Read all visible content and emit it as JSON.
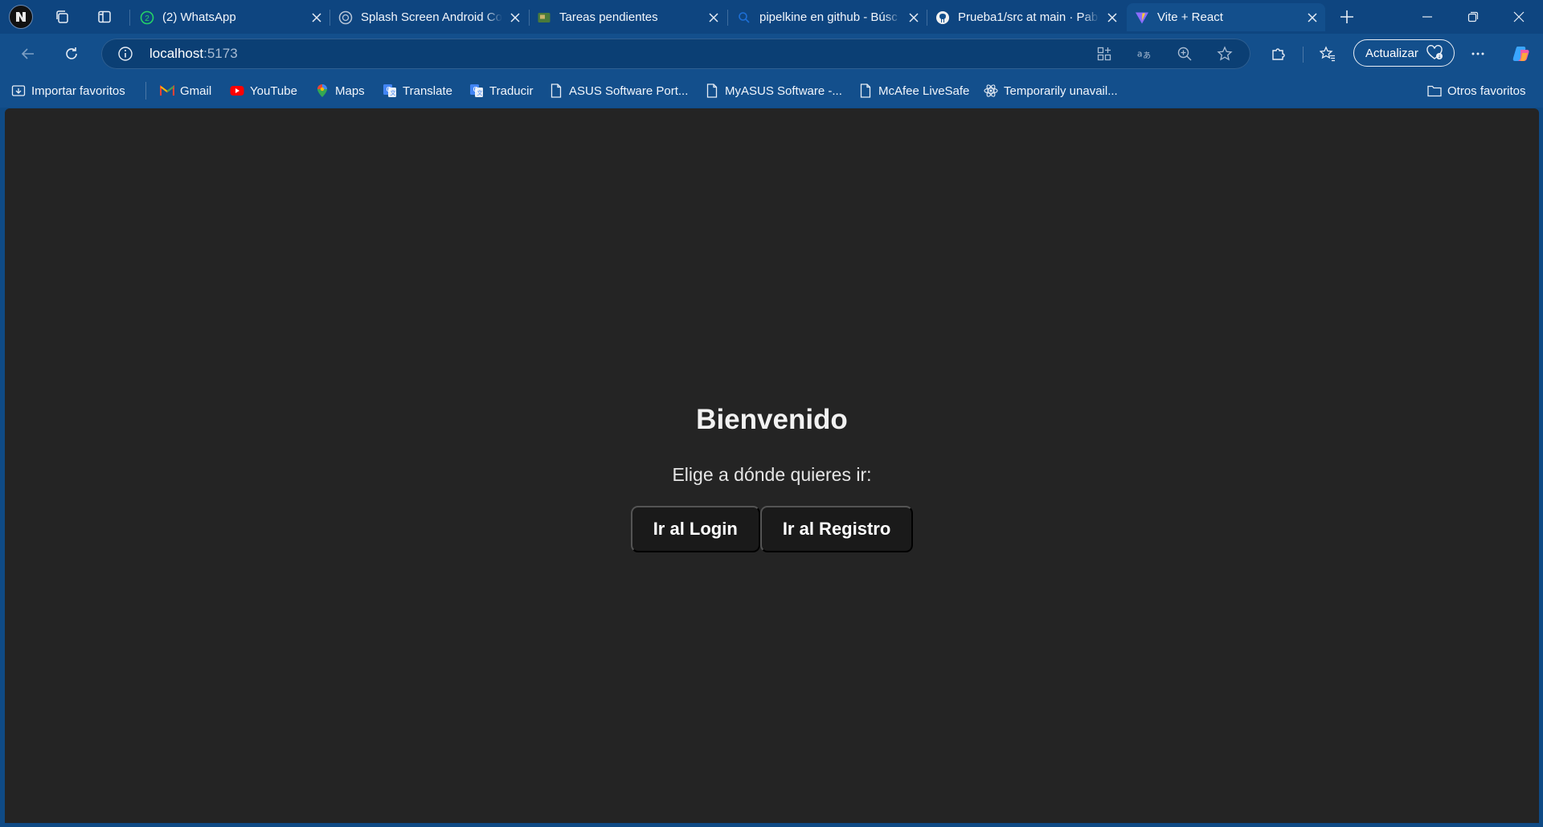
{
  "colors": {
    "chrome": "#134f8c",
    "tabstrip": "#0e4580",
    "page_bg": "#242424",
    "button_bg": "#1a1a1a"
  },
  "tabs": [
    {
      "title": "(2) WhatsApp",
      "icon": "whatsapp-icon"
    },
    {
      "title": "Splash Screen Android Co",
      "icon": "web-icon"
    },
    {
      "title": "Tareas pendientes",
      "icon": "tasks-icon"
    },
    {
      "title": "pipelkine en github - Búsc",
      "icon": "search-icon"
    },
    {
      "title": "Prueba1/src at main · Pabl",
      "icon": "github-icon"
    },
    {
      "title": "Vite + React",
      "icon": "vite-icon",
      "active": true
    }
  ],
  "toolbar": {
    "url_host": "localhost",
    "url_port": ":5173",
    "update_label": "Actualizar"
  },
  "bookmarks": {
    "import": "Importar favoritos",
    "items": [
      "Gmail",
      "YouTube",
      "Maps",
      "Translate",
      "Traducir",
      "ASUS Software Port...",
      "MyASUS Software -...",
      "McAfee LiveSafe",
      "Temporarily unavail..."
    ],
    "other": "Otros favoritos"
  },
  "page": {
    "title": "Bienvenido",
    "subtitle": "Elige a dónde quieres ir:",
    "login_button": "Ir al Login",
    "register_button": "Ir al Registro"
  }
}
